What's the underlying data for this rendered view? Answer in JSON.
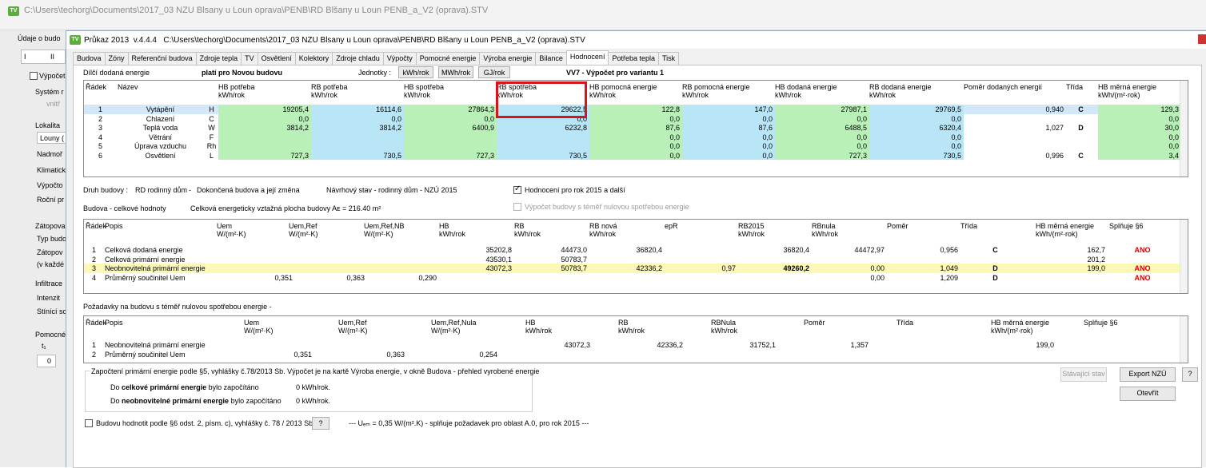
{
  "background": {
    "title": "C:\\Users\\techorg\\Documents\\2017_03 NZU Blsany u Loun oprava\\PENB\\RD Blšany u Loun PENB_a_V2 (oprava).STV",
    "tab": "Údaje o budo",
    "tab_i": "I",
    "tab_ii": "II",
    "vypocet": "Výpočet",
    "system": "Systém r",
    "vnitrni": "vnitř",
    "lokalita": "Lokalita",
    "louny": "Louny (",
    "nadmor": "Nadmoř",
    "klimat": "Klimatick",
    "vypocto": "Výpočto",
    "rocni": "Roční pr",
    "zatop": "Zátopova",
    "typbud": "Typ budo",
    "zatopov": "Zátopov",
    "kazde": "(v každé",
    "infil": "Infiltrace",
    "intenz": "Intenzit",
    "stinici": "Stínící so",
    "pomoc": "Pomocné",
    "t1": "t₁",
    "zero": "0"
  },
  "window": {
    "title_prefix": "Průkaz 2013",
    "version": "v.4.4.4",
    "path": "C:\\Users\\techorg\\Documents\\2017_03 NZU Blsany u Loun oprava\\PENB\\RD Blšany u Loun PENB_a_V2 (oprava).STV",
    "logo": "TV"
  },
  "tabs": [
    "Budova",
    "Zóny",
    "Referenční budova",
    "Zdroje tepla",
    "TV",
    "Osvětlení",
    "Kolektory",
    "Zdroje chladu",
    "Výpočty",
    "Pomocné energie",
    "Výroba energie",
    "Bilance",
    "Hodnocení",
    "Potřeba tepla",
    "Tisk"
  ],
  "active_tab": "Hodnocení",
  "top": {
    "label": "Dílčí dodaná energie",
    "plati": "platí pro Novou budovu",
    "jednotky_label": "Jednotky :",
    "units": [
      "kWh/rok",
      "MWh/rok",
      "GJ/rok"
    ],
    "variant": "VV7 - Výpočet pro variantu 1"
  },
  "energy_table": {
    "headers": [
      {
        "l1": "Řádek",
        "l2": ""
      },
      {
        "l1": "Název",
        "l2": ""
      },
      {
        "l1": "HB potřeba",
        "l2": "kWh/rok"
      },
      {
        "l1": "RB potřeba",
        "l2": "kWh/rok"
      },
      {
        "l1": "HB spotřeba",
        "l2": "kWh/rok"
      },
      {
        "l1": "RB spotřeba",
        "l2": "kWh/rok"
      },
      {
        "l1": "HB pomocná energie",
        "l2": "kWh/rok"
      },
      {
        "l1": "RB pomocná energie",
        "l2": "kWh/rok"
      },
      {
        "l1": "HB dodaná energie",
        "l2": "kWh/rok"
      },
      {
        "l1": "RB dodaná energie",
        "l2": "kWh/rok"
      },
      {
        "l1": "Poměr dodaných energií",
        "l2": ""
      },
      {
        "l1": "Třída",
        "l2": ""
      },
      {
        "l1": "HB měrná energie",
        "l2": "kWh/(m²·rok)"
      }
    ],
    "rows": [
      [
        "1",
        "Vytápění",
        "H",
        "19205,4",
        "16114,6",
        "27864,3",
        "29622,5",
        "122,8",
        "147,0",
        "27987,1",
        "29769,5",
        "0,940",
        "C",
        "129,3"
      ],
      [
        "2",
        "Chlazení",
        "C",
        "0,0",
        "0,0",
        "0,0",
        "0,0",
        "0,0",
        "0,0",
        "0,0",
        "0,0",
        "",
        "",
        "0,0"
      ],
      [
        "3",
        "Teplá voda",
        "W",
        "3814,2",
        "3814,2",
        "6400,9",
        "6232,8",
        "87,6",
        "87,6",
        "6488,5",
        "6320,4",
        "1,027",
        "D",
        "30,0"
      ],
      [
        "4",
        "Větrání",
        "F",
        "",
        "",
        "",
        "",
        "0,0",
        "0,0",
        "0,0",
        "0,0",
        "",
        "",
        "0,0"
      ],
      [
        "5",
        "Úprava vzduchu",
        "Rh",
        "",
        "",
        "",
        "",
        "0,0",
        "0,0",
        "0,0",
        "0,0",
        "",
        "",
        "0,0"
      ],
      [
        "6",
        "Osvětlení",
        "L",
        "727,3",
        "730,5",
        "727,3",
        "730,5",
        "0,0",
        "0,0",
        "727,3",
        "730,5",
        "0,996",
        "C",
        "3,4"
      ]
    ]
  },
  "druh": {
    "label": "Druh budovy :",
    "typ": "RD rodinný dům",
    "dokoncena": "Dokončená budova a její změna",
    "navrh": "Návrhový stav - rodinný dům - NZÚ 2015",
    "hodnoceni_cb": "Hodnocení pro rok 2015 a další",
    "vypocet_cb": "Výpočet budovy s téměř nulovou spotřebou energie"
  },
  "budova": {
    "label": "Budova - celkové hodnoty",
    "plocha": "Celková energeticky vztažná plocha budovy Aᴇ = 216.40 m²"
  },
  "total_table": {
    "headers": [
      {
        "l1": "Řádek",
        "l2": ""
      },
      {
        "l1": "Popis",
        "l2": ""
      },
      {
        "l1": "Uem",
        "l2": "W/(m²·K)"
      },
      {
        "l1": "Uem,Ref",
        "l2": "W/(m²·K)"
      },
      {
        "l1": "Uem,Ref,NB",
        "l2": "W/(m²·K)"
      },
      {
        "l1": "HB",
        "l2": "kWh/rok"
      },
      {
        "l1": "RB",
        "l2": "kWh/rok"
      },
      {
        "l1": "RB nová",
        "l2": "kWh/rok"
      },
      {
        "l1": "epR",
        "l2": ""
      },
      {
        "l1": "RB2015",
        "l2": "kWh/rok"
      },
      {
        "l1": "RBnula",
        "l2": "kWh/rok"
      },
      {
        "l1": "Poměr",
        "l2": ""
      },
      {
        "l1": "Třída",
        "l2": ""
      },
      {
        "l1": "HB měrná energie",
        "l2": "kWh/(m²·rok)"
      },
      {
        "l1": "Splňuje §6",
        "l2": ""
      }
    ],
    "rows": [
      [
        "1",
        "Celková dodaná energie",
        "",
        "",
        "",
        "35202,8",
        "44473,0",
        "36820,4",
        "",
        "36820,4",
        "44472,97",
        "0,956",
        "C",
        "162,7",
        "ANO"
      ],
      [
        "2",
        "Celková primární energie",
        "",
        "",
        "",
        "43530,1",
        "50783,7",
        "",
        "",
        "",
        "",
        "",
        "",
        "201,2",
        ""
      ],
      [
        "3",
        "Neobnovitelná primární energie",
        "",
        "",
        "",
        "43072,3",
        "50783,7",
        "42336,2",
        "0,97",
        "49260,2",
        "0,00",
        "1,049",
        "D",
        "199,0",
        "ANO"
      ],
      [
        "4",
        "Průměrný součinitel Uem",
        "0,351",
        "0,363",
        "0,290",
        "",
        "",
        "",
        "",
        "",
        "0,00",
        "1,209",
        "D",
        "",
        "ANO"
      ]
    ]
  },
  "nzeb": {
    "label": "Požadavky na budovu s téměř nulovou spotřebou energie -",
    "headers": [
      {
        "l1": "Řádek",
        "l2": ""
      },
      {
        "l1": "Popis",
        "l2": ""
      },
      {
        "l1": "Uem",
        "l2": "W/(m²·K)"
      },
      {
        "l1": "Uem,Ref",
        "l2": "W/(m²·K)"
      },
      {
        "l1": "Uem,Ref,Nula",
        "l2": "W/(m²·K)"
      },
      {
        "l1": "HB",
        "l2": "kWh/rok"
      },
      {
        "l1": "RB",
        "l2": "kWh/rok"
      },
      {
        "l1": "RBNula",
        "l2": "kWh/rok"
      },
      {
        "l1": "Poměr",
        "l2": ""
      },
      {
        "l1": "Třída",
        "l2": ""
      },
      {
        "l1": "HB měrná energie",
        "l2": "kWh/(m²·rok)"
      },
      {
        "l1": "Splňuje §6",
        "l2": ""
      }
    ],
    "rows": [
      [
        "1",
        "Neobnovitelná primární energie",
        "",
        "",
        "",
        "43072,3",
        "42336,2",
        "31752,1",
        "1,357",
        "",
        "199,0",
        ""
      ],
      [
        "2",
        "Průměrný součinitel Uem",
        "0,351",
        "0,363",
        "0,254",
        "",
        "",
        "",
        "",
        "",
        "",
        ""
      ]
    ]
  },
  "bottom": {
    "zapocteni": "Započtení primární energie podle §5, vyhlášky č.78/2013 Sb. Výpočet je na kartě Výroba energie, v okně Budova - přehled vyrobené energie",
    "do1": "Do",
    "celk": "celkové primární energie",
    "bylo1": "bylo započítáno",
    "val1": "0 kWh/rok.",
    "do2": "Do",
    "neob": "neobnovitelné primární energie",
    "bylo2": "bylo započítáno",
    "val2": "0 kWh/rok.",
    "hodnotit": "Budovu hodnotit podle §6 odst. 2, písm. c), vyhlášky č. 78 / 2013 Sb.",
    "q": "?",
    "uem_note": "--- Uₑₘ = 0,35 W/(m².K) - splňuje požadavek pro oblast A.0, pro rok 2015 ---",
    "stavajici": "Stávající stav",
    "export": "Export NZÚ",
    "otevrit": "Otevřít",
    "help": "?"
  }
}
